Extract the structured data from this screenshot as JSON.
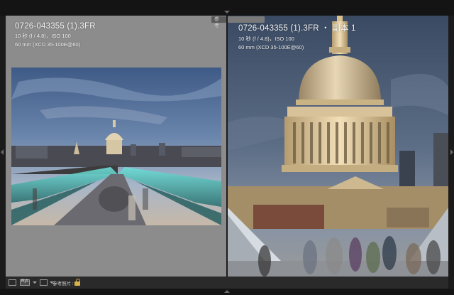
{
  "reference_tag": "参考",
  "current_tag": "",
  "left_photo": {
    "title": "0726-043355 (1).3FR",
    "exposure": "10 秒 (f / 4.8)，ISO 100",
    "lens": "60 mm (XCD 35-100E@60)"
  },
  "right_photo": {
    "title": "0726-043355 (1).3FR ・ 副本 1",
    "exposure": "10 秒 (f / 4.8)，ISO 100",
    "lens": "60 mm (XCD 35-100E@60)"
  },
  "toolbar": {
    "view_grid_label": "",
    "mode_label": "R|A",
    "compare_label": "",
    "reference_photo_label": "参考照片 :"
  }
}
